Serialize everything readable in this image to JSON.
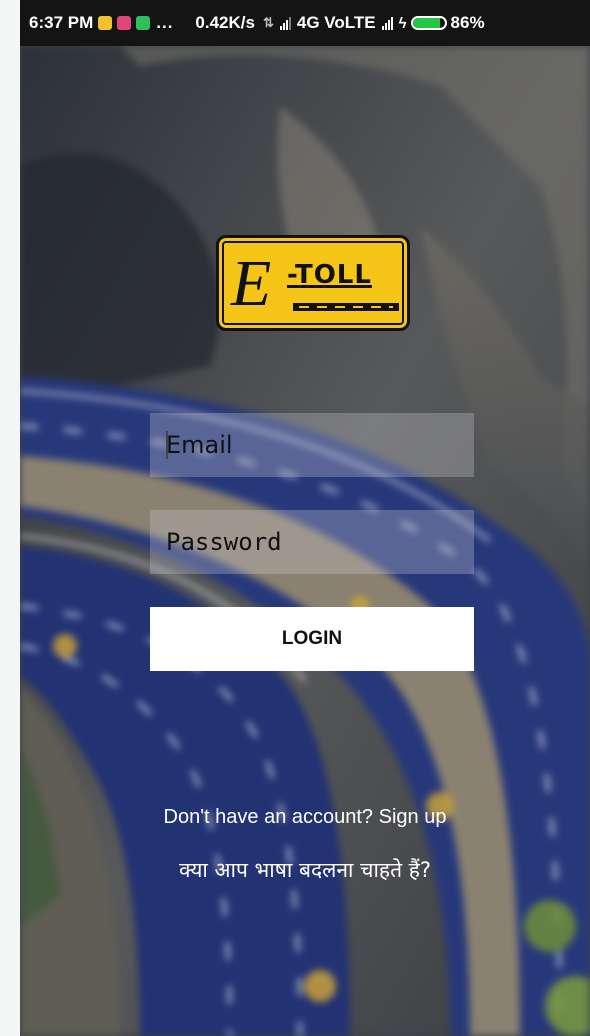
{
  "status_bar": {
    "time": "6:37 PM",
    "dots": "...",
    "speed": "0.42K/s",
    "network": "4G VoLTE",
    "battery_level": 0.86,
    "battery_text": "86%",
    "notification_icons": [
      "mail-notification-icon",
      "instagram-notification-icon",
      "app-notification-icon"
    ],
    "colors": {
      "background": "#141414",
      "battery_fill": "#23c745"
    }
  },
  "logo": {
    "letter": "E",
    "word": "-TOLL"
  },
  "login_form": {
    "email_placeholder": "Email",
    "password_placeholder": "Password",
    "login_label": "LOGIN"
  },
  "footer": {
    "signup_prompt": "Don't have an account? Sign up",
    "language_prompt": "क्या आप भाषा बदलना चाहते हैं?"
  },
  "colors": {
    "logo_yellow": "#f5c518",
    "button_bg": "#ffffff",
    "text_light": "#ffffff"
  }
}
